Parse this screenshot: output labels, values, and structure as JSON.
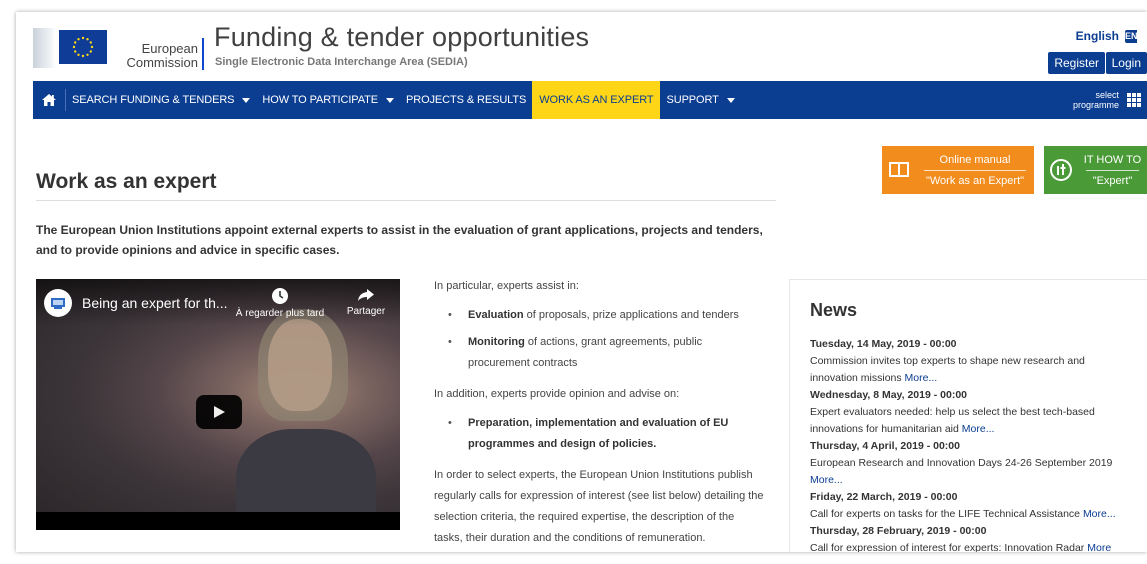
{
  "header": {
    "ec_line1": "European",
    "ec_line2": "Commission",
    "title": "Funding & tender opportunities",
    "subtitle": "Single Electronic Data Interchange Area (SEDIA)",
    "language": "English",
    "language_code": "EN",
    "register": "Register",
    "login": "Login"
  },
  "nav": {
    "items": [
      {
        "label": "SEARCH FUNDING & TENDERS",
        "dropdown": true
      },
      {
        "label": "HOW TO PARTICIPATE",
        "dropdown": true
      },
      {
        "label": "PROJECTS & RESULTS",
        "dropdown": false
      },
      {
        "label": "WORK AS AN EXPERT",
        "dropdown": false,
        "active": true
      },
      {
        "label": "SUPPORT",
        "dropdown": true
      }
    ],
    "select_line1": "select",
    "select_line2": "programme"
  },
  "manuals": {
    "online_top": "Online manual",
    "online_bottom": "\"Work as an Expert\"",
    "it_top": "IT HOW TO",
    "it_bottom": "\"Expert\""
  },
  "page": {
    "title": "Work as an expert",
    "intro": "The European Union Institutions appoint external experts to assist in the evaluation of grant applications, projects and tenders, and to provide opinions and advice in specific cases."
  },
  "video": {
    "title": "Being an expert for th...",
    "watch_later": "À regarder plus tard",
    "share": "Partager"
  },
  "middle": {
    "p1": "In particular, experts assist in:",
    "list1": [
      {
        "bold": "Evaluation",
        "rest": " of proposals, prize applications and tenders"
      },
      {
        "bold": "Monitoring",
        "rest": " of actions, grant agreements, public procurement contracts"
      }
    ],
    "p2": "In addition, experts provide opinion and advise on:",
    "list2": [
      {
        "bold": "Preparation, implementation and evaluation of EU programmes and design of policies.",
        "rest": ""
      }
    ],
    "p3": "In order to select experts, the European Union Institutions publish regularly calls for expression of interest (see list below) detailing the selection criteria, the required expertise, the description of the tasks, their duration and the conditions of remuneration."
  },
  "news": {
    "title": "News",
    "items": [
      {
        "date": "Tuesday, 14 May, 2019 - 00:00",
        "text": "Commission invites top experts to shape new research and innovation missions ",
        "more": "More..."
      },
      {
        "date": "Wednesday, 8 May, 2019 - 00:00",
        "text": "Expert evaluators needed: help us select the best tech-based innovations for humanitarian aid ",
        "more": "More..."
      },
      {
        "date": "Thursday, 4 April, 2019 - 00:00",
        "text": "European Research and Innovation Days 24-26 September 2019 ",
        "more": "More..."
      },
      {
        "date": "Friday, 22 March, 2019 - 00:00",
        "text": "Call for experts on tasks for the LIFE Technical Assistance ",
        "more": "More..."
      },
      {
        "date": "Thursday, 28 February, 2019 - 00:00",
        "text": "Call for expression of interest for experts: Innovation Radar ",
        "more": "More"
      }
    ]
  },
  "colors": {
    "nav_blue": "#0b3d91",
    "active_yellow": "#ffd617",
    "manual_orange": "#f28c1c",
    "manual_green": "#4a9a37"
  }
}
